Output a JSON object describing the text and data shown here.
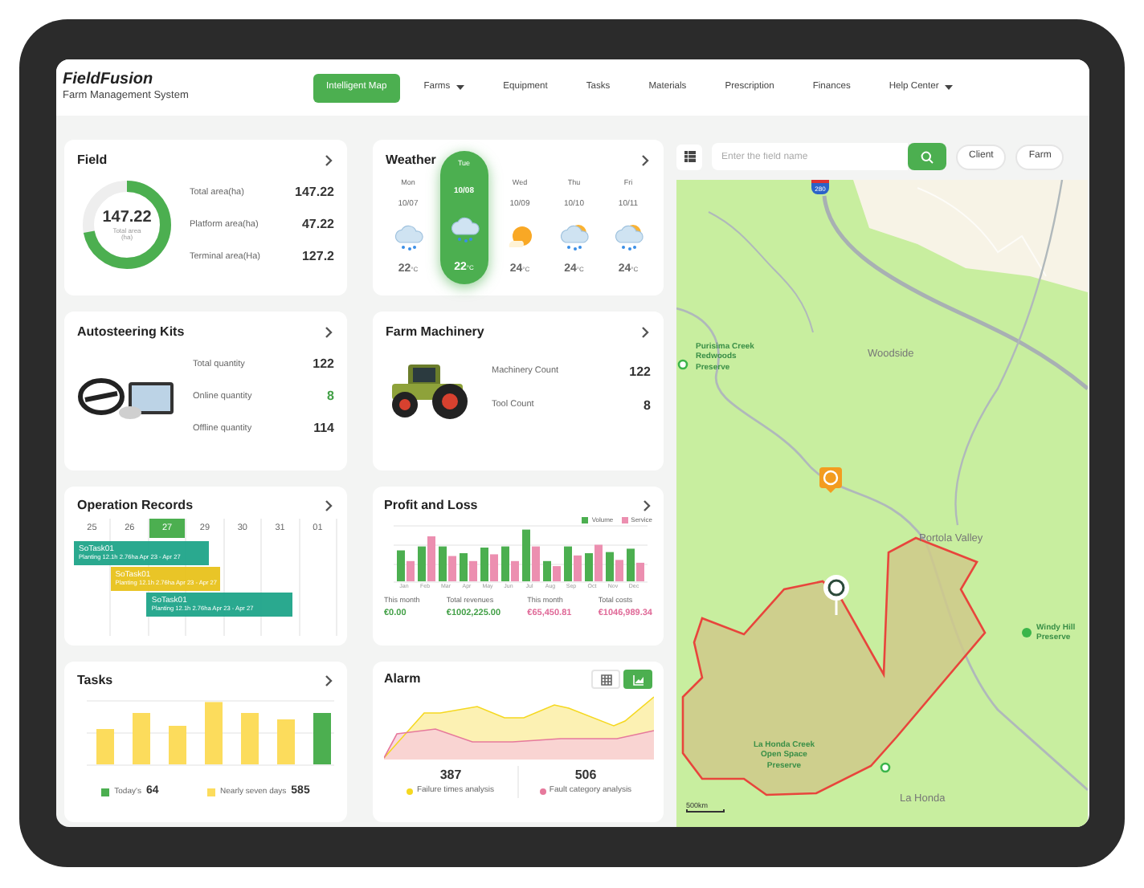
{
  "header": {
    "logo": "FieldFusion",
    "subtitle": "Farm Management System",
    "nav": [
      {
        "label": "Intelligent Map",
        "selected": true,
        "dropdown": false
      },
      {
        "label": "Farms",
        "selected": false,
        "dropdown": true
      },
      {
        "label": "Equipment",
        "selected": false,
        "dropdown": false
      },
      {
        "label": "Tasks",
        "selected": false,
        "dropdown": false
      },
      {
        "label": "Materials",
        "selected": false,
        "dropdown": false
      },
      {
        "label": "Prescription",
        "selected": false,
        "dropdown": false
      },
      {
        "label": "Finances",
        "selected": false,
        "dropdown": false
      },
      {
        "label": "Help Center",
        "selected": false,
        "dropdown": true
      }
    ]
  },
  "field": {
    "title": "Field",
    "total": "147.22",
    "total_label": "Total area",
    "unit": "(ha)",
    "level": 0.72,
    "stats": [
      {
        "label": "Total area(ha)",
        "value": "147.22"
      },
      {
        "label": "Platform area(ha)",
        "value": "47.22"
      },
      {
        "label": "Terminal area(Ha)",
        "value": "127.2"
      }
    ]
  },
  "weather": {
    "title": "Weather",
    "days": [
      {
        "day": "Mon",
        "date": "10/07",
        "temp": "22",
        "unit": "°C",
        "kind": "rain",
        "selected": false
      },
      {
        "day": "Tue",
        "date": "10/08",
        "temp": "22",
        "unit": "°C",
        "kind": "rain",
        "selected": true
      },
      {
        "day": "Wed",
        "date": "10/09",
        "temp": "24",
        "unit": "°C",
        "kind": "sun",
        "selected": false
      },
      {
        "day": "Thu",
        "date": "10/10",
        "temp": "24",
        "unit": "°C",
        "kind": "sun-rain",
        "selected": false
      },
      {
        "day": "Fri",
        "date": "10/11",
        "temp": "24",
        "unit": "°C",
        "kind": "sun-rain",
        "selected": false
      }
    ]
  },
  "autosteering": {
    "title": "Autosteering Kits",
    "stats": [
      {
        "label": "Total quantity",
        "value": "122",
        "color": "#333333"
      },
      {
        "label": "Online quantity",
        "value": "8",
        "color": "#43a047"
      },
      {
        "label": "Offline quantity",
        "value": "114",
        "color": "#333333"
      }
    ]
  },
  "machinery": {
    "title": "Farm Machinery",
    "stats": [
      {
        "label": "Machinery Count",
        "value": "122"
      },
      {
        "label": "Tool Count",
        "value": "8"
      }
    ]
  },
  "operations": {
    "title": "Operation Records",
    "dates": [
      {
        "label": "25",
        "selected": false
      },
      {
        "label": "26",
        "selected": false
      },
      {
        "label": "27",
        "selected": true
      },
      {
        "label": "29",
        "selected": false
      },
      {
        "label": "30",
        "selected": false
      },
      {
        "label": "31",
        "selected": false
      },
      {
        "label": "01",
        "selected": false
      }
    ],
    "tasks": [
      {
        "name": "SoTask01",
        "detail": "Planting 12.1h 2.76ha Apr 23 - Apr 27",
        "color": "#1fa58a"
      },
      {
        "name": "SoTask01",
        "detail": "Planting 12.1h 2.76ha Apr 23 - Apr 27",
        "color": "#e8c21c"
      },
      {
        "name": "SoTask01",
        "detail": "Planting 12.1h 2.76ha Apr 23 - Apr 27",
        "color": "#1fa58a"
      }
    ]
  },
  "profit": {
    "title": "Profit and Loss",
    "legend": [
      {
        "label": "Volume",
        "color": "#4caf50"
      },
      {
        "label": "Service",
        "color": "#ec8fb0"
      }
    ],
    "months": [
      "Jan",
      "Feb",
      "Mar",
      "Apr",
      "May",
      "Jun",
      "Jul",
      "Aug",
      "Sep",
      "Oct",
      "Nov",
      "Dec"
    ],
    "stats": [
      {
        "label": "This month",
        "value": "€0.00",
        "color": "#43a047"
      },
      {
        "label": "Total revenues",
        "value": "€1002,225.00",
        "color": "#43a047"
      },
      {
        "label": "This month",
        "value": "€65,450.81",
        "color": "#e06a98"
      },
      {
        "label": "Total costs",
        "value": "€1046,989.34",
        "color": "#e06a98"
      }
    ]
  },
  "tasks": {
    "title": "Tasks",
    "legend": [
      {
        "label": "Today's",
        "value": "64",
        "color": "#4caf50"
      },
      {
        "label": "Nearly seven days",
        "value": "585",
        "color": "#fcdc5c"
      }
    ]
  },
  "alarm": {
    "title": "Alarm",
    "view_toggle": [
      {
        "kind": "table",
        "selected": false
      },
      {
        "kind": "chart",
        "selected": true
      }
    ],
    "stats": [
      {
        "value": "387",
        "label": "Failure times analysis",
        "color": "#f5d820"
      },
      {
        "value": "506",
        "label": "Fault category analysis",
        "color": "#e6799c"
      }
    ]
  },
  "map": {
    "search": {
      "placeholder": "Enter the field name"
    },
    "chips": [
      "Client",
      "Farm"
    ],
    "shield": "280",
    "scale": "500km",
    "labels": [
      {
        "text": "Purisima Creek Redwoods Preserve",
        "kind": "park"
      },
      {
        "text": "Woodside",
        "kind": "town"
      },
      {
        "text": "Portola Valley",
        "kind": "town"
      },
      {
        "text": "Windy Hill Preserve",
        "kind": "park-dot"
      },
      {
        "text": "La Honda Creek Open Space Preserve",
        "kind": "park"
      },
      {
        "text": "La Honda",
        "kind": "town"
      }
    ]
  }
}
